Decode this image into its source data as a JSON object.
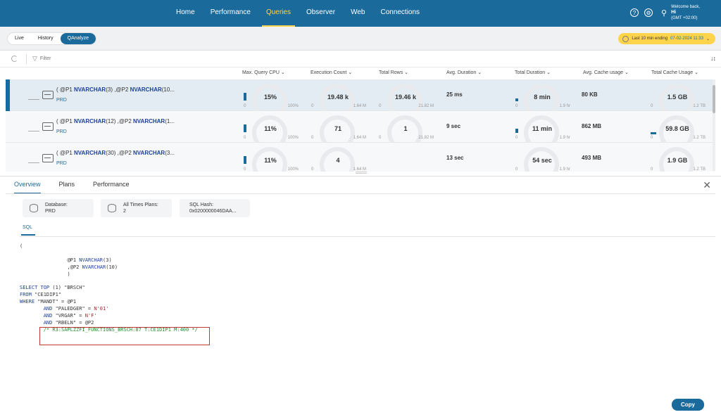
{
  "nav": {
    "items": [
      "Home",
      "Performance",
      "Queries",
      "Observer",
      "Web",
      "Connections"
    ],
    "active_index": 2
  },
  "user": {
    "welcome": "Welcome back,",
    "name": "Hi",
    "timezone": "(GMT +02:00)"
  },
  "modes": [
    "Live",
    "History",
    "QAnalyze"
  ],
  "time_range": {
    "label": "Last 10 min ending",
    "date": "07-02-2024 11:33"
  },
  "filter": {
    "label": "Filter"
  },
  "columns": [
    "Max. Query CPU",
    "Execution Count",
    "Total Rows",
    "Avg. Duration",
    "Total Duration",
    "Avg. Cache usage",
    "Total Cache Usage"
  ],
  "rows": [
    {
      "query_prefix": "( @P1 ",
      "query_type1": "NVARCHAR",
      "query_mid": "(3) ,@P2 ",
      "query_type2": "NVARCHAR",
      "query_suffix": "(10...",
      "database": "PRD",
      "cpu": "15%",
      "cpu_min": "0",
      "cpu_max": "100%",
      "exec": "19.48 k",
      "exec_min": "0",
      "exec_max": "1.64 M",
      "rows": "19.46 k",
      "rows_min": "0",
      "rows_max": "21.82 M",
      "avg_duration": "25 ms",
      "total_duration": "8 min",
      "td_min": "0",
      "td_max": "1.9 hr",
      "avg_cache": "80 KB",
      "total_cache": "1.5 GB",
      "tc_min": "0",
      "tc_max": "1.2 TB",
      "selected": true
    },
    {
      "query_prefix": "( @P1 ",
      "query_type1": "NVARCHAR",
      "query_mid": "(12) ,@P2 ",
      "query_type2": "NVARCHAR",
      "query_suffix": "(1...",
      "database": "PRD",
      "cpu": "11%",
      "cpu_min": "0",
      "cpu_max": "100%",
      "exec": "71",
      "exec_min": "0",
      "exec_max": "1.64 M",
      "rows": "1",
      "rows_min": "0",
      "rows_max": "21.82 M",
      "avg_duration": "9 sec",
      "total_duration": "11 min",
      "td_min": "0",
      "td_max": "1.9 hr",
      "avg_cache": "862 MB",
      "total_cache": "59.8 GB",
      "tc_min": "0",
      "tc_max": "1.2 TB",
      "selected": false
    },
    {
      "query_prefix": "( @P1 ",
      "query_type1": "NVARCHAR",
      "query_mid": "(30) ,@P2 ",
      "query_type2": "NVARCHAR",
      "query_suffix": "(3...",
      "database": "PRD",
      "cpu": "11%",
      "cpu_min": "0",
      "cpu_max": "100%",
      "exec": "4",
      "exec_min": "0",
      "exec_max": "1.64 M",
      "rows": "",
      "rows_min": "",
      "rows_max": "",
      "avg_duration": "13 sec",
      "total_duration": "54 sec",
      "td_min": "0",
      "td_max": "1.9 hr",
      "avg_cache": "493 MB",
      "total_cache": "1.9 GB",
      "tc_min": "0",
      "tc_max": "1.2 TB",
      "selected": false
    }
  ],
  "detail": {
    "tabs": [
      "Overview",
      "Plans",
      "Performance"
    ],
    "active_tab": 0,
    "cards": [
      {
        "label": "Database:",
        "value": "PRD"
      },
      {
        "label": "All Times Plans:",
        "value": "2"
      },
      {
        "label": "SQL Hash:",
        "value": "0x0200000046DAA..."
      }
    ],
    "sql_tab": "SQL",
    "copy_label": "Copy"
  },
  "sql_lines": [
    {
      "indent": "",
      "parts": [
        {
          "t": "(",
          "c": ""
        }
      ]
    },
    {
      "indent": "",
      "parts": [
        {
          "t": "",
          "c": ""
        }
      ]
    },
    {
      "indent": "                ",
      "parts": [
        {
          "t": "@P1 ",
          "c": ""
        },
        {
          "t": "NVARCHAR",
          "c": "k"
        },
        {
          "t": "(3)",
          "c": ""
        }
      ]
    },
    {
      "indent": "                ",
      "parts": [
        {
          "t": ",@P2 ",
          "c": ""
        },
        {
          "t": "NVARCHAR",
          "c": "k"
        },
        {
          "t": "(10)",
          "c": ""
        }
      ]
    },
    {
      "indent": "                ",
      "parts": [
        {
          "t": ")",
          "c": ""
        }
      ]
    },
    {
      "indent": "",
      "parts": [
        {
          "t": "",
          "c": ""
        }
      ]
    },
    {
      "indent": "",
      "parts": [
        {
          "t": "SELECT TOP ",
          "c": "k"
        },
        {
          "t": "(1) \"BRSCH\"",
          "c": ""
        }
      ]
    },
    {
      "indent": "",
      "parts": [
        {
          "t": "FROM ",
          "c": "k"
        },
        {
          "t": "\"CE1DIP1\"",
          "c": ""
        }
      ]
    },
    {
      "indent": "",
      "parts": [
        {
          "t": "WHERE ",
          "c": "k"
        },
        {
          "t": "\"MANDT\" = @P1",
          "c": ""
        }
      ]
    },
    {
      "indent": "        ",
      "parts": [
        {
          "t": "AND ",
          "c": "k"
        },
        {
          "t": "\"PALEDGER\" = ",
          "c": ""
        },
        {
          "t": "N'01'",
          "c": "s"
        }
      ]
    },
    {
      "indent": "        ",
      "parts": [
        {
          "t": "AND ",
          "c": "k"
        },
        {
          "t": "\"VRGAR\" = ",
          "c": ""
        },
        {
          "t": "N'F'",
          "c": "s"
        }
      ]
    },
    {
      "indent": "        ",
      "parts": [
        {
          "t": "AND ",
          "c": "k"
        },
        {
          "t": "\"RBELN\" = @P2",
          "c": ""
        }
      ]
    },
    {
      "indent": "        ",
      "parts": [
        {
          "t": "/* R3:SAPLZZFI_FUNCTIONS_BRSCH:87 T:CE1DIP1 M:400 */",
          "c": "c"
        }
      ]
    }
  ]
}
